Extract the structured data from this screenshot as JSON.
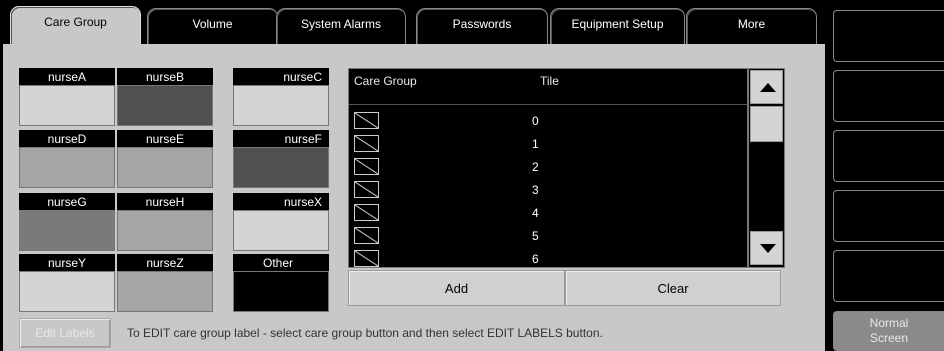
{
  "tabs": [
    {
      "label": "Care Group",
      "active": true
    },
    {
      "label": "Volume",
      "active": false
    },
    {
      "label": "System Alarms",
      "active": false
    },
    {
      "label": "Passwords",
      "active": false
    },
    {
      "label": "Equipment Setup",
      "active": false
    },
    {
      "label": "More",
      "active": false
    }
  ],
  "care_groups": [
    {
      "label": "nurseA",
      "color": "#d4d4d4"
    },
    {
      "label": "nurseB",
      "color": "#505050"
    },
    {
      "label": "nurseC",
      "color": "#d4d4d4"
    },
    {
      "label": "nurseD",
      "color": "#a5a5a5"
    },
    {
      "label": "nurseE",
      "color": "#a5a5a5"
    },
    {
      "label": "nurseF",
      "color": "#505050"
    },
    {
      "label": "nurseG",
      "color": "#7a7a7a"
    },
    {
      "label": "nurseH",
      "color": "#a5a5a5"
    },
    {
      "label": "nurseX",
      "color": "#d4d4d4"
    },
    {
      "label": "nurseY",
      "color": "#d4d4d4"
    },
    {
      "label": "nurseZ",
      "color": "#a5a5a5"
    },
    {
      "label": "Other",
      "color": "#000000"
    }
  ],
  "table": {
    "headers": {
      "col1": "Care Group",
      "col2": "Tile"
    },
    "rows": [
      {
        "tile": "0"
      },
      {
        "tile": "1"
      },
      {
        "tile": "2"
      },
      {
        "tile": "3"
      },
      {
        "tile": "4"
      },
      {
        "tile": "5"
      },
      {
        "tile": "6"
      }
    ]
  },
  "buttons": {
    "add": "Add",
    "clear": "Clear",
    "edit_labels": "Edit Labels"
  },
  "help_text": "To EDIT care group label - select care group button and then select EDIT LABELS button.",
  "side_buttons": {
    "normal_screen_line1": "Normal",
    "normal_screen_line2": "Screen"
  }
}
